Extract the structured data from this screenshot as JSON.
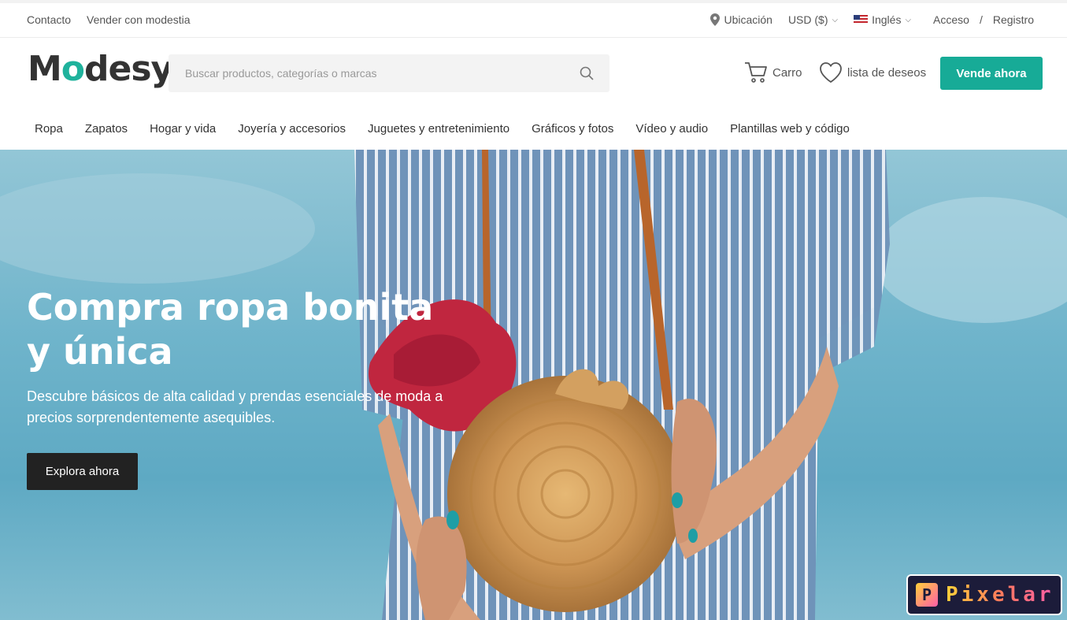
{
  "topbar": {
    "contact": "Contacto",
    "sell_modesty": "Vender con modestia",
    "location": "Ubicación",
    "currency": "USD ($)",
    "language": "Inglés",
    "login": "Acceso",
    "separator": "/",
    "register": "Registro"
  },
  "header": {
    "logo_prefix": "M",
    "logo_o": "o",
    "logo_suffix": "desy",
    "search_placeholder": "Buscar productos, categorías o marcas",
    "cart": "Carro",
    "wishlist": "lista de deseos",
    "sell_now": "Vende ahora"
  },
  "nav": {
    "items": [
      "Ropa",
      "Zapatos",
      "Hogar y vida",
      "Joyería y accesorios",
      "Juguetes y entretenimiento",
      "Gráficos y fotos",
      "Vídeo y audio",
      "Plantillas web y código"
    ]
  },
  "hero": {
    "title": "Compra ropa bonita y única",
    "subtitle": "Descubre básicos de alta calidad y prendas esenciales de moda a precios sorprendentemente asequibles.",
    "cta": "Explora ahora"
  },
  "badge": {
    "logo": "Pixelar"
  },
  "colors": {
    "accent": "#17ab97",
    "dark_button": "#222222",
    "sky": "#6fb4cb"
  }
}
